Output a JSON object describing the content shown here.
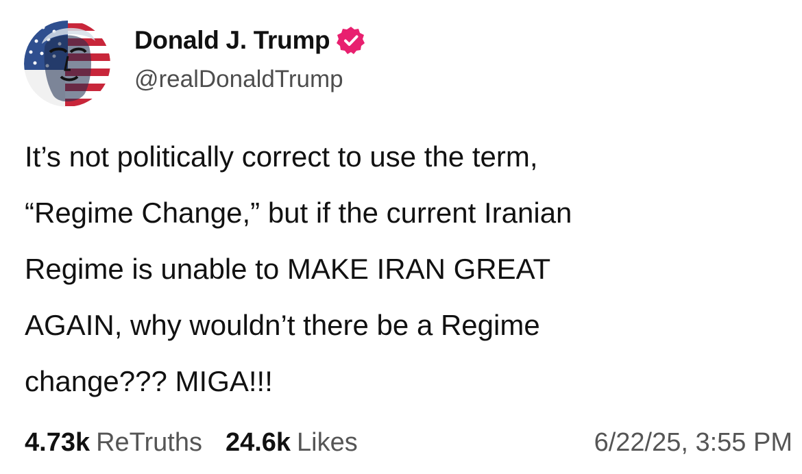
{
  "author": {
    "display_name": "Donald J. Trump",
    "handle": "@realDonaldTrump",
    "verified": true,
    "verified_color": "#e8206f",
    "avatar_icon": "profile-photo-flag-portrait"
  },
  "post": {
    "lines": [
      "It’s not politically correct to use the term,",
      "“Regime Change,” but if the current Iranian",
      "Regime is unable to MAKE IRAN GREAT",
      "AGAIN, why wouldn’t there be a Regime",
      "change??? MIGA!!!"
    ]
  },
  "stats": {
    "retruths_count": "4.73k",
    "retruths_label": "ReTruths",
    "likes_count": "24.6k",
    "likes_label": "Likes"
  },
  "timestamp": "6/22/25, 3:55 PM",
  "colors": {
    "text": "#111111",
    "secondary_text": "#555555",
    "background": "#ffffff"
  }
}
